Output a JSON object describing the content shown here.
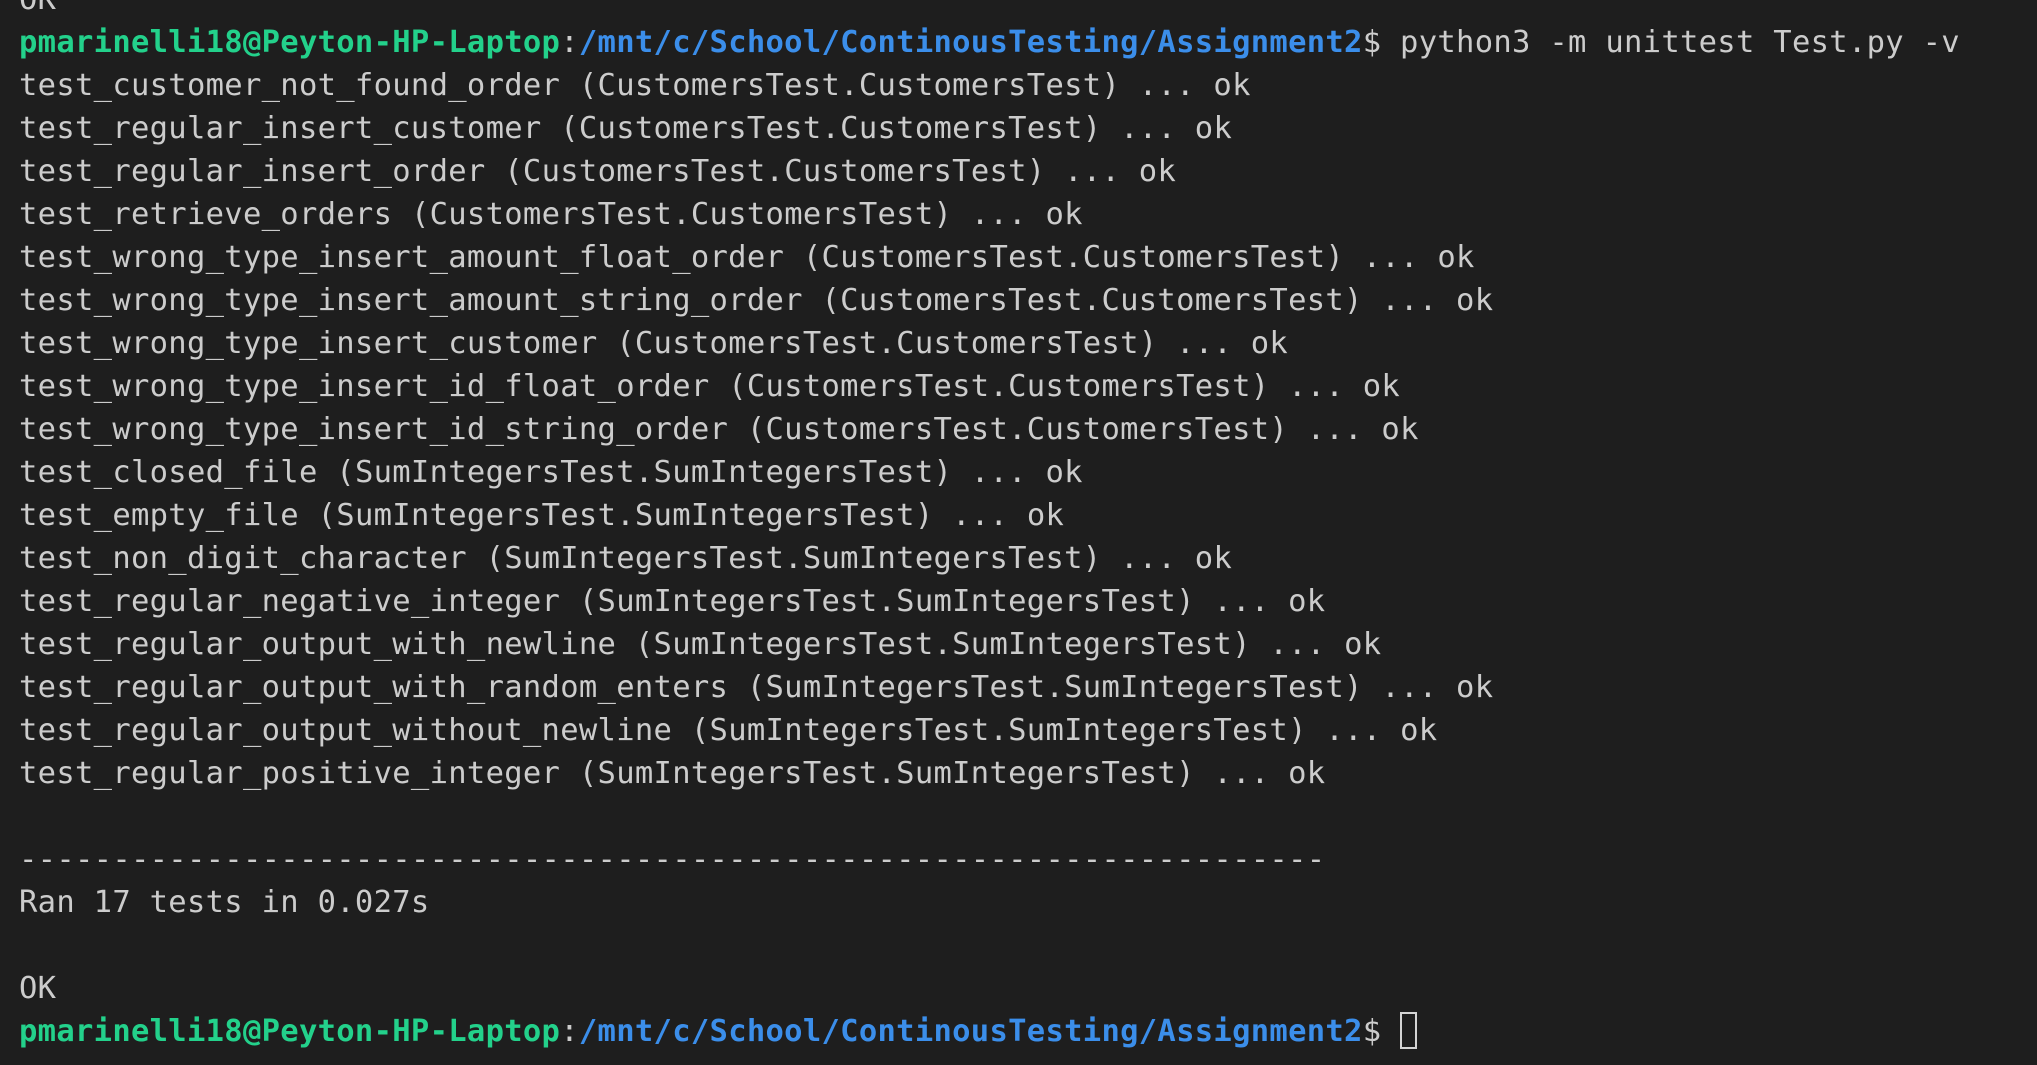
{
  "prompt": {
    "user_host": "pmarinelli18@Peyton-HP-Laptop",
    "separator": ":",
    "path": "/mnt/c/School/ContinousTesting/Assignment2",
    "symbol": "$ "
  },
  "previous_output": "OK",
  "command": "python3 -m unittest Test.py -v",
  "tests": [
    {
      "name": "test_customer_not_found_order",
      "class": "(CustomersTest.CustomersTest)",
      "result": "... ok"
    },
    {
      "name": "test_regular_insert_customer",
      "class": "(CustomersTest.CustomersTest)",
      "result": "... ok"
    },
    {
      "name": "test_regular_insert_order",
      "class": "(CustomersTest.CustomersTest)",
      "result": "... ok"
    },
    {
      "name": "test_retrieve_orders",
      "class": "(CustomersTest.CustomersTest)",
      "result": "... ok"
    },
    {
      "name": "test_wrong_type_insert_amount_float_order",
      "class": "(CustomersTest.CustomersTest)",
      "result": "... ok"
    },
    {
      "name": "test_wrong_type_insert_amount_string_order",
      "class": "(CustomersTest.CustomersTest)",
      "result": "... ok"
    },
    {
      "name": "test_wrong_type_insert_customer",
      "class": "(CustomersTest.CustomersTest)",
      "result": "... ok"
    },
    {
      "name": "test_wrong_type_insert_id_float_order",
      "class": "(CustomersTest.CustomersTest)",
      "result": "... ok"
    },
    {
      "name": "test_wrong_type_insert_id_string_order",
      "class": "(CustomersTest.CustomersTest)",
      "result": "... ok"
    },
    {
      "name": "test_closed_file",
      "class": "(SumIntegersTest.SumIntegersTest)",
      "result": "... ok"
    },
    {
      "name": "test_empty_file",
      "class": "(SumIntegersTest.SumIntegersTest)",
      "result": "... ok"
    },
    {
      "name": "test_non_digit_character",
      "class": "(SumIntegersTest.SumIntegersTest)",
      "result": "... ok"
    },
    {
      "name": "test_regular_negative_integer",
      "class": "(SumIntegersTest.SumIntegersTest)",
      "result": "... ok"
    },
    {
      "name": "test_regular_output_with_newline",
      "class": "(SumIntegersTest.SumIntegersTest)",
      "result": "... ok"
    },
    {
      "name": "test_regular_output_with_random_enters",
      "class": "(SumIntegersTest.SumIntegersTest)",
      "result": "... ok"
    },
    {
      "name": "test_regular_output_without_newline",
      "class": "(SumIntegersTest.SumIntegersTest)",
      "result": "... ok"
    },
    {
      "name": "test_regular_positive_integer",
      "class": "(SumIntegersTest.SumIntegersTest)",
      "result": "... ok"
    }
  ],
  "separator_line": "----------------------------------------------------------------------",
  "summary": "Ran 17 tests in 0.027s",
  "final_status": "OK",
  "colors": {
    "background": "#1e1e1e",
    "text": "#cccccc",
    "prompt_user": "#23d18b",
    "prompt_path": "#3b8eea"
  }
}
